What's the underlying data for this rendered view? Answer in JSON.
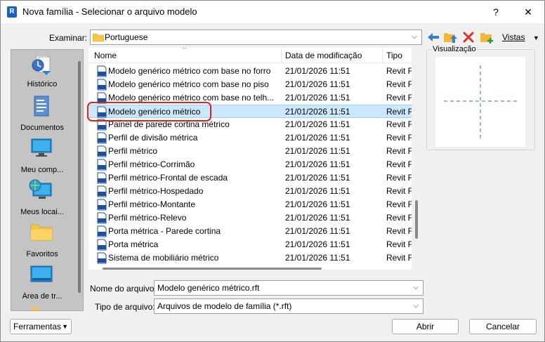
{
  "window": {
    "app_icon_letter": "R",
    "title": "Nova família - Selecionar o arquivo modelo",
    "help_label": "?",
    "close_label": "✕"
  },
  "lookin": {
    "label": "Examinar:",
    "value": "Portuguese"
  },
  "toolbar": {
    "views_label": "Vistas",
    "icons": [
      "back-arrow-icon",
      "up-folder-icon",
      "delete-icon",
      "new-folder-icon"
    ]
  },
  "places": [
    {
      "label": "Histórico",
      "icon": "history-icon"
    },
    {
      "label": "Documentos",
      "icon": "documents-icon"
    },
    {
      "label": "Meu comp...",
      "icon": "computer-icon"
    },
    {
      "label": "Meus locai...",
      "icon": "network-icon"
    },
    {
      "label": "Favoritos",
      "icon": "folder-icon"
    },
    {
      "label": "Área de tr...",
      "icon": "desktop-icon"
    }
  ],
  "filelist": {
    "columns": {
      "name": "Nome",
      "date": "Data de modificação",
      "type": "Tipo"
    },
    "rows": [
      {
        "name": "Modelo genérico métrico com base no forro",
        "date": "21/01/2026 11:51",
        "type": "Revit F"
      },
      {
        "name": "Modelo genérico métrico com base no piso",
        "date": "21/01/2026 11:51",
        "type": "Revit F"
      },
      {
        "name": "Modelo genérico métrico com base no telh...",
        "date": "21/01/2026 11:51",
        "type": "Revit F"
      },
      {
        "name": "Modelo genérico métrico",
        "date": "21/01/2026 11:51",
        "type": "Revit F",
        "selected": true
      },
      {
        "name": "Painel de parede cortina métrico",
        "date": "21/01/2026 11:51",
        "type": "Revit F"
      },
      {
        "name": "Perfil de divisão métrica",
        "date": "21/01/2026 11:51",
        "type": "Revit F"
      },
      {
        "name": "Perfil métrico",
        "date": "21/01/2026 11:51",
        "type": "Revit F"
      },
      {
        "name": "Perfil métrico-Corrimão",
        "date": "21/01/2026 11:51",
        "type": "Revit F"
      },
      {
        "name": "Perfil métrico-Frontal de escada",
        "date": "21/01/2026 11:51",
        "type": "Revit F"
      },
      {
        "name": "Perfil métrico-Hospedado",
        "date": "21/01/2026 11:51",
        "type": "Revit F"
      },
      {
        "name": "Perfil métrico-Montante",
        "date": "21/01/2026 11:51",
        "type": "Revit F"
      },
      {
        "name": "Perfil métrico-Relevo",
        "date": "21/01/2026 11:51",
        "type": "Revit F"
      },
      {
        "name": "Porta métrica - Parede cortina",
        "date": "21/01/2026 11:51",
        "type": "Revit F"
      },
      {
        "name": "Porta métrica",
        "date": "21/01/2026 11:51",
        "type": "Revit F"
      },
      {
        "name": "Sistema de mobiliário métrico",
        "date": "21/01/2026 11:51",
        "type": "Revit F"
      }
    ]
  },
  "preview": {
    "label": "Visualização"
  },
  "filename": {
    "label": "Nome do arquivo:",
    "value": "Modelo genérico métrico.rft"
  },
  "filetype": {
    "label": "Tipo de arquivo:",
    "value": "Arquivos de modelo de família (*.rft)"
  },
  "tools": {
    "label": "Ferramentas"
  },
  "buttons": {
    "open": "Abrir",
    "cancel": "Cancelar"
  },
  "colors": {
    "selection": "#cce8ff",
    "highlight_ring": "#e0201a",
    "preview_crosshair": "#2e8b2e"
  }
}
